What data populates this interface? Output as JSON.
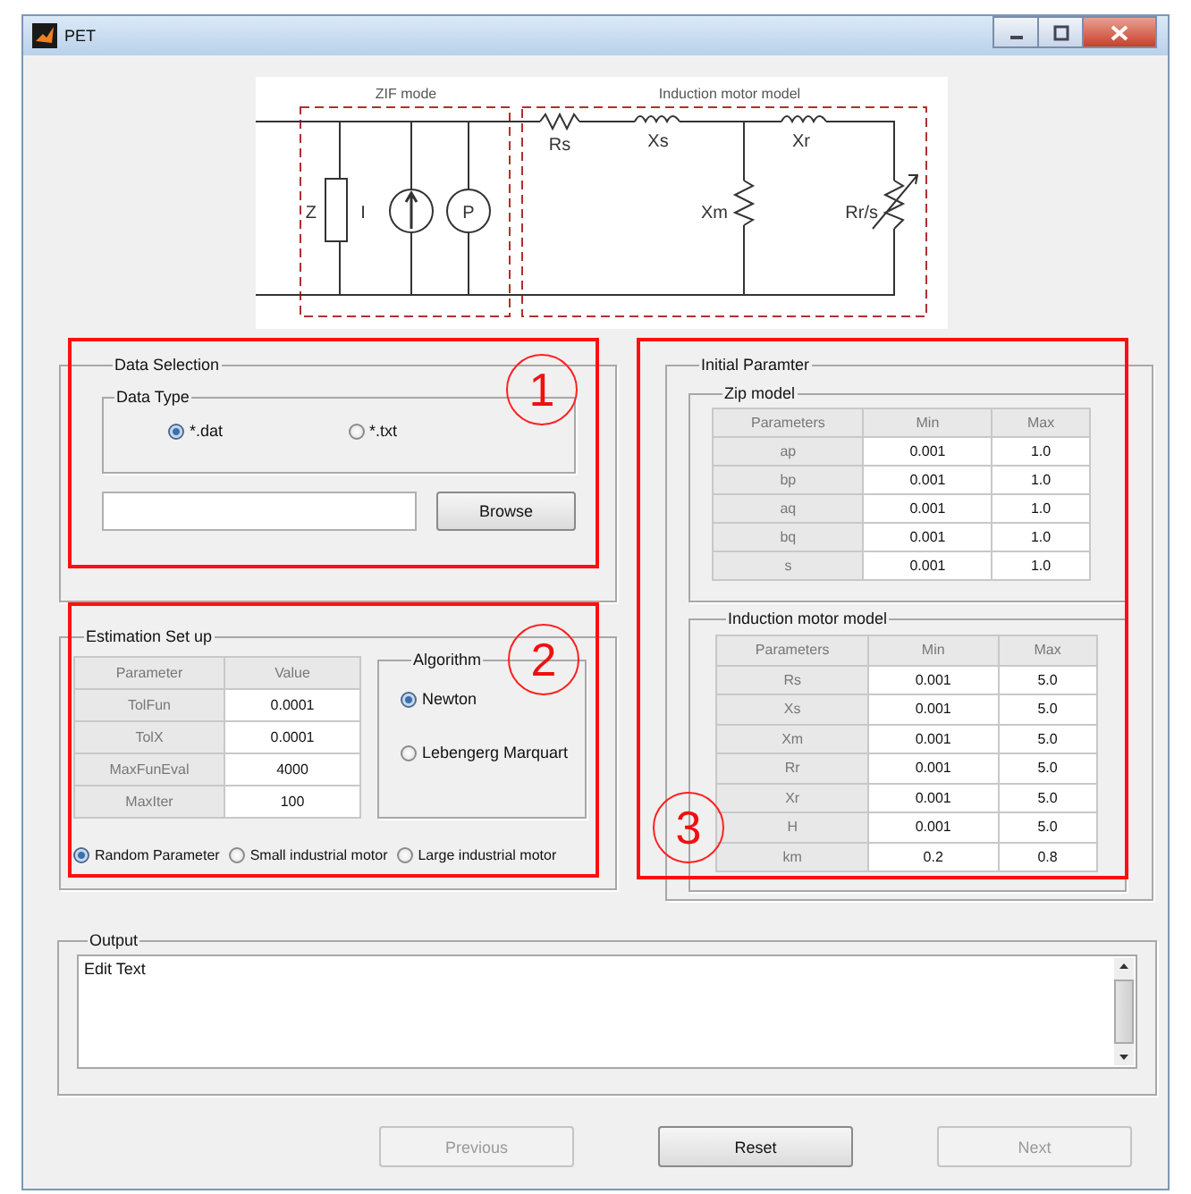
{
  "window": {
    "title": "PET"
  },
  "diagram": {
    "sections": [
      "ZIF mode",
      "Induction motor model"
    ],
    "labels": [
      "Z",
      "I",
      "P",
      "Rs",
      "Xs",
      "Xm",
      "Xr",
      "Rr/s"
    ]
  },
  "data_selection": {
    "title": "Data Selection",
    "data_type": {
      "title": "Data Type",
      "options": [
        {
          "label": "*.dat",
          "selected": true
        },
        {
          "label": "*.txt",
          "selected": false
        }
      ]
    },
    "browse_button": "Browse"
  },
  "estimation": {
    "title": "Estimation Set up",
    "table": {
      "columns": [
        "Parameter",
        "Value"
      ],
      "rows": [
        [
          "TolFun",
          "0.0001"
        ],
        [
          "TolX",
          "0.0001"
        ],
        [
          "MaxFunEval",
          "4000"
        ],
        [
          "MaxIter",
          "100"
        ]
      ]
    },
    "algorithm": {
      "title": "Algorithm",
      "options": [
        {
          "label": "Newton",
          "selected": true
        },
        {
          "label": "Lebengerg Marquart",
          "selected": false
        }
      ]
    },
    "presets": [
      {
        "label": "Random Parameter",
        "selected": true
      },
      {
        "label": "Small industrial motor",
        "selected": false
      },
      {
        "label": "Large industrial motor",
        "selected": false
      }
    ]
  },
  "initial_parameter": {
    "title": "Initial Paramter",
    "groups": [
      {
        "title": "Zip model",
        "columns": [
          "Parameters",
          "Min",
          "Max"
        ],
        "rows": [
          [
            "ap",
            "0.001",
            "1.0"
          ],
          [
            "bp",
            "0.001",
            "1.0"
          ],
          [
            "aq",
            "0.001",
            "1.0"
          ],
          [
            "bq",
            "0.001",
            "1.0"
          ],
          [
            "s",
            "0.001",
            "1.0"
          ]
        ]
      },
      {
        "title": "Induction motor model",
        "columns": [
          "Parameters",
          "Min",
          "Max"
        ],
        "rows": [
          [
            "Rs",
            "0.001",
            "5.0"
          ],
          [
            "Xs",
            "0.001",
            "5.0"
          ],
          [
            "Xm",
            "0.001",
            "5.0"
          ],
          [
            "Rr",
            "0.001",
            "5.0"
          ],
          [
            "Xr",
            "0.001",
            "5.0"
          ],
          [
            "H",
            "0.001",
            "5.0"
          ],
          [
            "km",
            "0.2",
            "0.8"
          ]
        ]
      }
    ]
  },
  "output": {
    "title": "Output",
    "value": "Edit Text"
  },
  "buttons": [
    {
      "label": "Previous",
      "disabled": true
    },
    {
      "label": "Reset",
      "disabled": false
    },
    {
      "label": "Next",
      "disabled": true
    }
  ],
  "annotations": [
    "1",
    "2",
    "3"
  ]
}
